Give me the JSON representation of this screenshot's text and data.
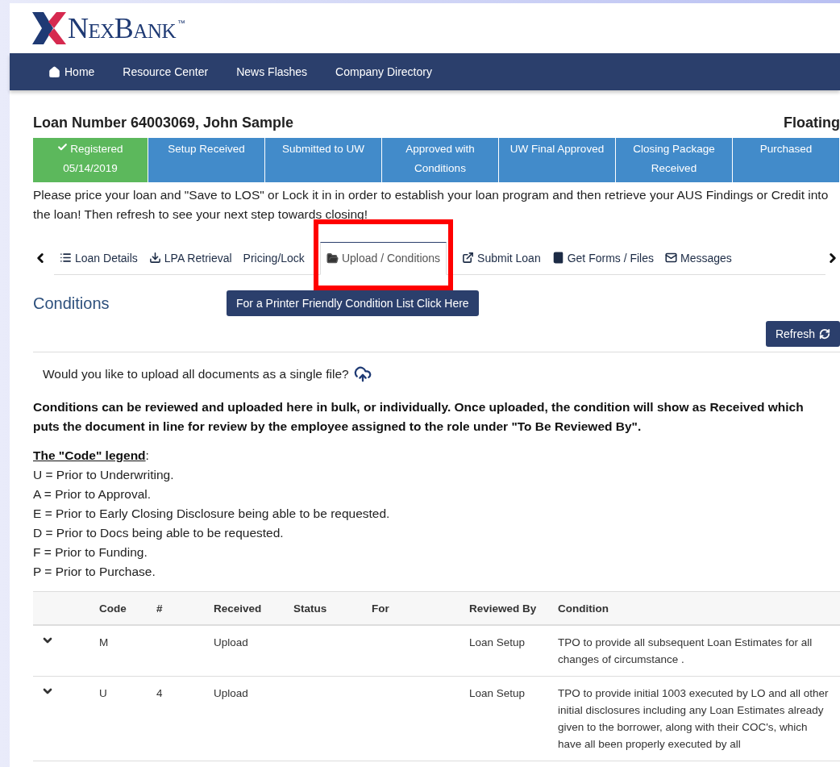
{
  "logo": {
    "text": "NexBank",
    "trademark": "™"
  },
  "nav": [
    {
      "label": "Home"
    },
    {
      "label": "Resource Center"
    },
    {
      "label": "News Flashes"
    },
    {
      "label": "Company Directory"
    }
  ],
  "loan_title": "Loan Number 64003069, John Sample",
  "loan_status": "Floating",
  "stages": [
    {
      "label": "Registered",
      "date": "05/14/2019",
      "completed": true
    },
    {
      "label": "Setup Received",
      "completed": false
    },
    {
      "label": "Submitted to UW",
      "completed": false
    },
    {
      "label": "Approved with Conditions",
      "completed": false
    },
    {
      "label": "UW Final Approved",
      "completed": false
    },
    {
      "label": "Closing Package Received",
      "completed": false
    },
    {
      "label": "Purchased",
      "completed": false
    }
  ],
  "instruction": "Please price your loan and \"Save to LOS\" or Lock it in in order to establish your loan program and then retrieve your AUS Findings or Credit into the loan! Then refresh to see your next step towards closing!",
  "tabs": [
    {
      "label": "Loan Details",
      "selected": false
    },
    {
      "label": "LPA Retrieval",
      "selected": false
    },
    {
      "label": "Pricing/Lock",
      "selected": false
    },
    {
      "label": "Upload / Conditions",
      "selected": true
    },
    {
      "label": "Submit Loan",
      "selected": false
    },
    {
      "label": "Get Forms / Files",
      "selected": false
    },
    {
      "label": "Messages",
      "selected": false
    }
  ],
  "section_title": "Conditions",
  "printer_button": "For a Printer Friendly Condition List Click Here",
  "refresh_button": "Refresh",
  "upload_prompt": "Would you like to upload all documents as a single file?",
  "bulk_note": "Conditions can be reviewed and uploaded here in bulk, or individually. Once uploaded, the condition will show as Received which puts the document in line for review by the employee assigned to the role under \"To Be Reviewed By\".",
  "legend": {
    "title": "The \"Code\" legend",
    "suffix": ":",
    "items": [
      "U = Prior to Underwriting.",
      "A = Prior to Approval.",
      "E = Prior to Early Closing Disclosure being able to be requested.",
      "D = Prior to Docs being able to be requested.",
      "F = Prior to Funding.",
      "P = Prior to Purchase."
    ]
  },
  "table": {
    "columns": [
      "Code",
      "#",
      "Received",
      "Status",
      "For",
      "Reviewed By",
      "Condition"
    ],
    "rows": [
      {
        "code": "M",
        "received": "Upload",
        "reviewed_by": "Loan Setup",
        "condition": "TPO to provide all subsequent Loan Estimates for all changes of circumstance ."
      },
      {
        "code": "U",
        "number": "4",
        "received": "Upload",
        "reviewed_by": "Loan Setup",
        "condition": "TPO to provide initial 1003 executed by LO and all other initial disclosures including any Loan Estimates already given to the borrower, along with their COC's, which have all been properly executed by all"
      }
    ]
  }
}
